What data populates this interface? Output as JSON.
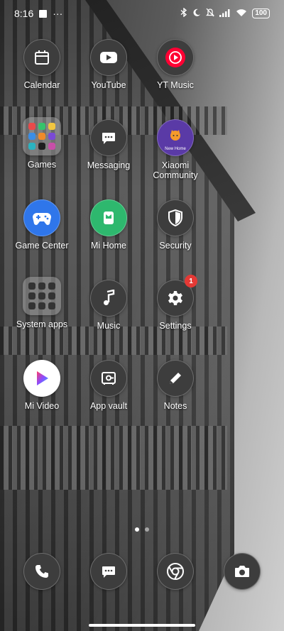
{
  "status_bar": {
    "time": "8:16",
    "more": "···",
    "battery": "100"
  },
  "apps": {
    "calendar": "Calendar",
    "youtube": "YouTube",
    "yt_music": "YT Music",
    "games": "Games",
    "messaging": "Messaging",
    "xiaomi_community": "Xiaomi\nCommunity",
    "game_center": "Game Center",
    "mi_home": "Mi Home",
    "security": "Security",
    "system_apps": "System apps",
    "music": "Music",
    "settings": "Settings",
    "settings_badge": "1",
    "mi_video": "Mi Video",
    "app_vault": "App vault",
    "notes": "Notes",
    "xiaomi_community_icon_text": "New Home"
  },
  "dock": {
    "items": [
      "phone-icon",
      "messages-icon",
      "chrome-icon",
      "camera-icon"
    ]
  },
  "pager": {
    "pages": 2,
    "active": 0
  }
}
